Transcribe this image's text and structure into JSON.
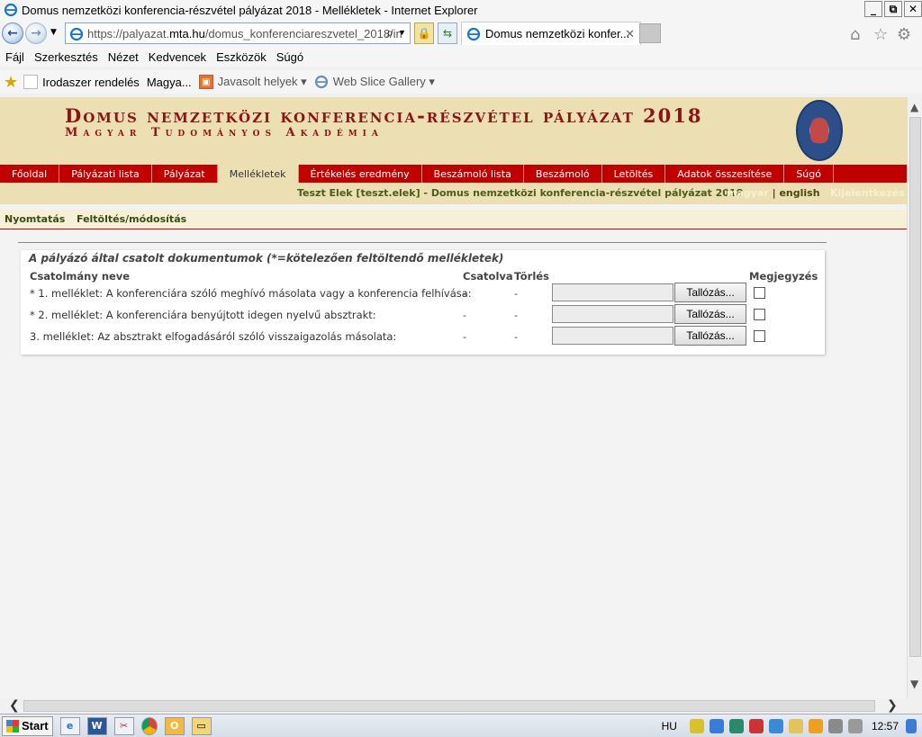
{
  "window": {
    "title": "Domus nemzetközi konferencia-részvétel pályázat 2018 - Mellékletek - Internet Explorer",
    "controls": [
      "_",
      "⧉",
      "✕"
    ]
  },
  "addressbar": {
    "url_prefix": "https://palyazat.",
    "url_domain": "mta.hu",
    "url_path": "/domus_konferenciareszvetel_2018/in",
    "tab_title": "Domus nemzetközi konfer...",
    "tab_close": "✕"
  },
  "menubar": {
    "items": [
      "Fájl",
      "Szerkesztés",
      "Nézet",
      "Kedvencek",
      "Eszközök",
      "Súgó"
    ]
  },
  "favorites": {
    "items": [
      {
        "label": "Irodaszer rendelés"
      },
      {
        "label": "Magya..."
      },
      {
        "label": "Javasolt helyek ▾"
      },
      {
        "label": "Web Slice Gallery ▾"
      }
    ]
  },
  "header": {
    "title": "Domus nemzetközi konferencia-részvétel pályázat 2018",
    "subtitle": "Magyar Tudományos Akadémia"
  },
  "nav": {
    "items": [
      {
        "label": "Főoldal",
        "active": false
      },
      {
        "label": "Pályázati lista",
        "active": false
      },
      {
        "label": "Pályázat",
        "active": false
      },
      {
        "label": "Mellékletek",
        "active": true
      },
      {
        "label": "Értékelés eredmény",
        "active": false
      },
      {
        "label": "Beszámoló lista",
        "active": false
      },
      {
        "label": "Beszámoló",
        "active": false
      },
      {
        "label": "Letöltés",
        "active": false
      },
      {
        "label": "Adatok összesítése",
        "active": false
      },
      {
        "label": "Súgó",
        "active": false
      }
    ]
  },
  "userbar": {
    "user": "Teszt Elek [teszt.elek] - Domus nemzetközi konferencia-részvétel pályázat 2018",
    "lang_hu": "magyar",
    "lang_sep": " | ",
    "lang_en": "english",
    "logout": "Kijelentkezés"
  },
  "subnav": {
    "print": "Nyomtatás",
    "upload": "Feltöltés/módosítás"
  },
  "attachments": {
    "title": "A pályázó által csatolt dokumentumok (*=kötelezően feltöltendő mellékletek)",
    "headers": {
      "name": "Csatolmány neve",
      "attached": "Csatolva",
      "delete": "Törlés",
      "note": "Megjegyzés"
    },
    "rows": [
      {
        "label": "* 1. melléklet: A konferenciára szóló meghívó másolata vagy a konferencia felhívása:",
        "attached": "-",
        "delete": "-",
        "browse": "Tallózás...",
        "file_value": "",
        "checked": false
      },
      {
        "label": "* 2. melléklet: A konferenciára benyújtott idegen nyelvű absztrakt:",
        "attached": "-",
        "delete": "-",
        "browse": "Tallózás...",
        "file_value": "",
        "checked": false
      },
      {
        "label": "3. melléklet: Az absztrakt elfogadásáról szóló visszaigazolás másolata:",
        "attached": "-",
        "delete": "-",
        "browse": "Tallózás...",
        "file_value": "",
        "checked": false
      }
    ]
  },
  "taskbar": {
    "start": "Start",
    "lang": "HU",
    "clock": "12:57"
  }
}
